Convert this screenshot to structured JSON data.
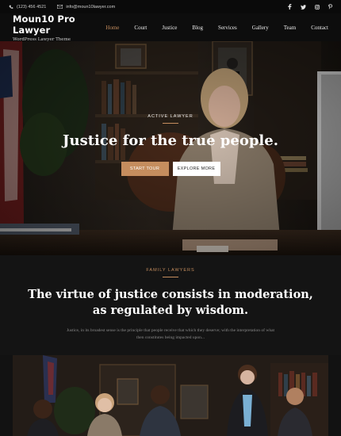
{
  "topbar": {
    "phone": "(123) 456 4521",
    "email": "info@moun10lawyer.com",
    "phone_icon": "phone-icon",
    "email_icon": "envelope-icon",
    "social": [
      "facebook-icon",
      "twitter-icon",
      "instagram-icon",
      "pinterest-icon"
    ]
  },
  "header": {
    "title": "Moun10 Pro Lawyer",
    "subtitle": "WordPress Lawyer Theme",
    "nav": [
      "Home",
      "Court",
      "Justice",
      "Blog",
      "Services",
      "Gallery",
      "Team",
      "Contact"
    ],
    "active_nav": "Home"
  },
  "hero": {
    "kicker": "ACTIVE LAWYER",
    "title": "Justice for the true people.",
    "primary_button": "START TOUR",
    "secondary_button": "EXPLORE MORE"
  },
  "intro": {
    "kicker": "FAMILY LAWYERS",
    "title_line1": "The virtue of justice consists in moderation,",
    "title_line2": "as regulated by wisdom.",
    "body_line1": "Justice, in its broadest sense is the principle that people receive that which they deserve; with the interpretation of what",
    "body_line2": "then constitutes being impacted upon..."
  },
  "colors": {
    "accent": "#c58d5e",
    "background": "#121212",
    "header_bg": "#0d0d0d"
  }
}
